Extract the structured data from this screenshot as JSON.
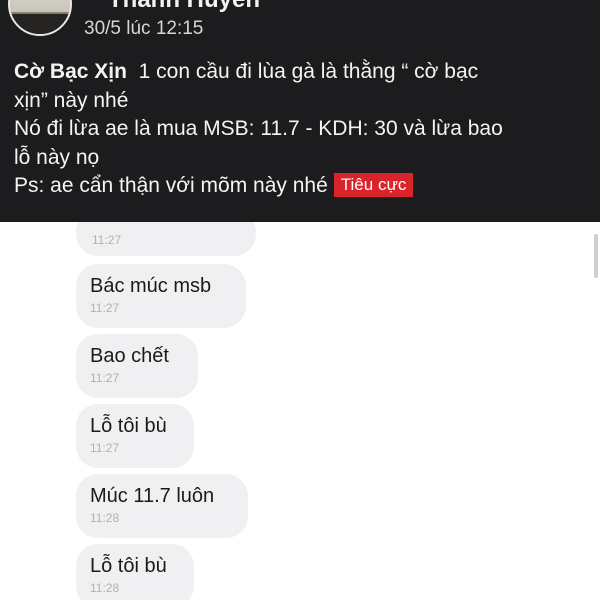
{
  "post": {
    "poster_name": "Thanh Huyền",
    "time": "30/5 lúc 12:15",
    "author_tag": "Cờ Bạc Xịn",
    "line1_rest": "1 con cầu đi lùa gà là thằng “ cờ bạc",
    "line2": "xịn” này nhé",
    "line3": "Nó đi lừa ae là mua MSB: 11.7 - KDH: 30 và lừa bao",
    "line4": "lỗ này nọ",
    "line5": "Ps: ae cẩn thận với mõm này nhé",
    "badge": "Tiêu cực",
    "badge_color": "#d9242b",
    "background_color": "#1c1c1e"
  },
  "chat": {
    "bubble_color": "#f0f0f2",
    "messages": [
      {
        "text": "",
        "time": "11:27"
      },
      {
        "text": "Bác múc msb",
        "time": "11:27"
      },
      {
        "text": "Bao chết",
        "time": "11:27"
      },
      {
        "text": "Lỗ tôi bù",
        "time": "11:27"
      },
      {
        "text": "Múc 11.7 luôn",
        "time": "11:28"
      },
      {
        "text": "Lỗ tôi bù",
        "time": "11:28"
      }
    ]
  }
}
